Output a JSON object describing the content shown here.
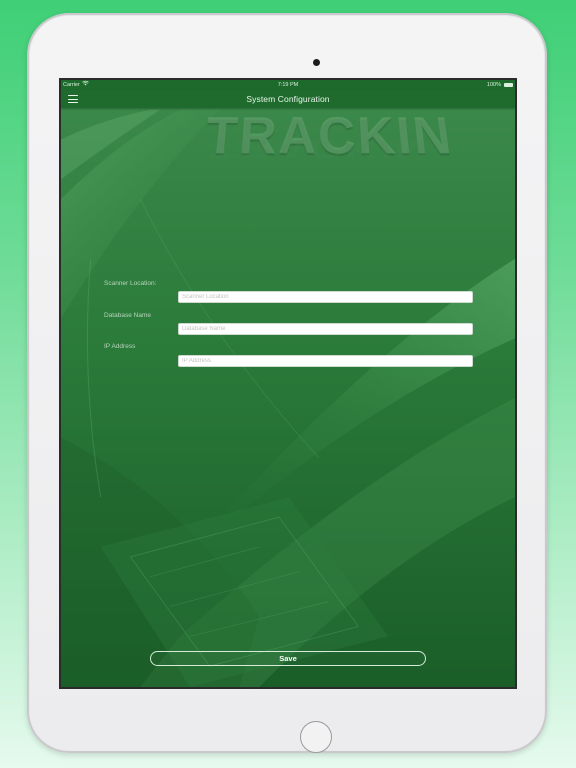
{
  "status_bar": {
    "carrier": "Carrier",
    "time": "7:19 PM",
    "battery": "100%",
    "wifi_icon": "wifi-icon",
    "battery_icon": "battery-icon"
  },
  "nav": {
    "title": "System Configuration",
    "menu_icon": "hamburger-menu-icon"
  },
  "background": {
    "watermark_text": "TRACKIN"
  },
  "form": {
    "scanner_location": {
      "label": "Scanner Location:",
      "placeholder": "Scanner Location",
      "value": ""
    },
    "database_name": {
      "label": "Database Name",
      "placeholder": "Database Name",
      "value": ""
    },
    "ip_address": {
      "label": "IP Address",
      "placeholder": "IP Address",
      "value": ""
    }
  },
  "actions": {
    "save_label": "Save"
  },
  "colors": {
    "page_gradient_top": "#3fcf76",
    "screen_green": "#1f6a2f",
    "nav_green": "#1f6b2d",
    "label_text": "#b6d5bb"
  }
}
